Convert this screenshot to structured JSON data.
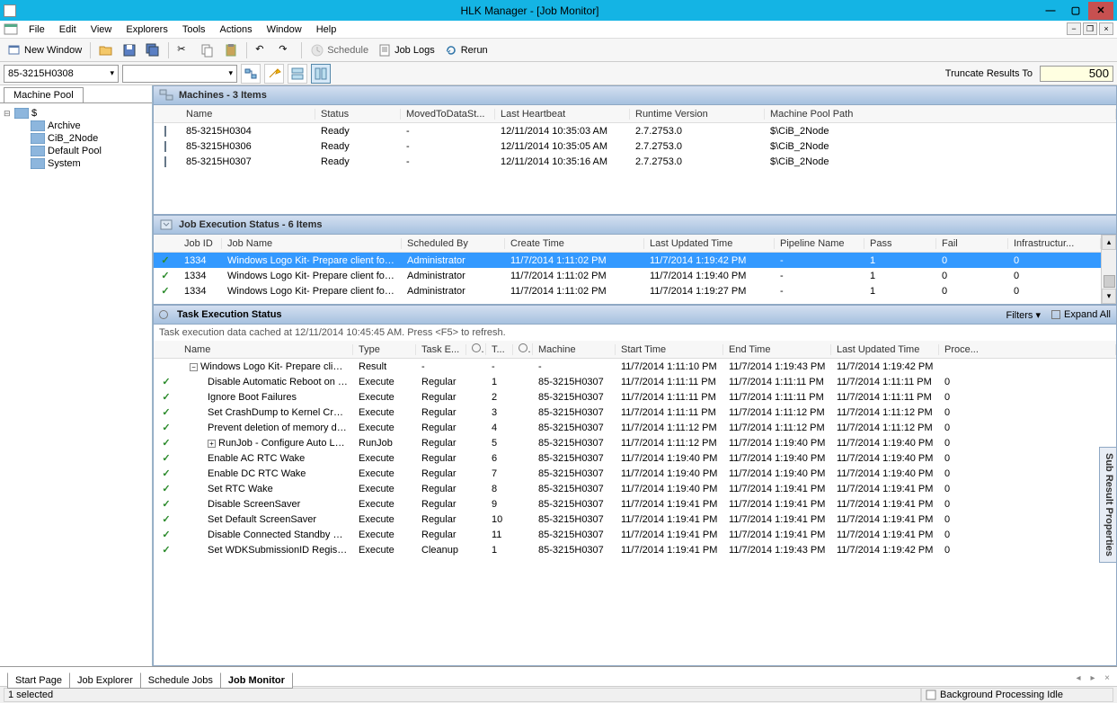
{
  "window": {
    "title": "HLK Manager - [Job Monitor]"
  },
  "menu": [
    "File",
    "Edit",
    "View",
    "Explorers",
    "Tools",
    "Actions",
    "Window",
    "Help"
  ],
  "toolbar": {
    "new_window": "New Window",
    "schedule": "Schedule",
    "job_logs": "Job Logs",
    "rerun": "Rerun"
  },
  "toolbar2": {
    "combo1": "85-3215H0308",
    "combo2": "",
    "truncate_label": "Truncate Results To",
    "truncate_value": "500"
  },
  "tree": {
    "tab": "Machine Pool",
    "root": "$",
    "children": [
      "Archive",
      "CiB_2Node",
      "Default Pool",
      "System"
    ]
  },
  "panels": {
    "machines": {
      "title": "Machines - 3 Items",
      "columns": [
        "Name",
        "Status",
        "MovedToDataSt...",
        "Last Heartbeat",
        "Runtime Version",
        "Machine Pool Path"
      ],
      "rows": [
        {
          "name": "85-3215H0304",
          "status": "Ready",
          "moved": "-",
          "hb": "12/11/2014 10:35:03 AM",
          "rt": "2.7.2753.0",
          "path": "$\\CiB_2Node"
        },
        {
          "name": "85-3215H0306",
          "status": "Ready",
          "moved": "-",
          "hb": "12/11/2014 10:35:05 AM",
          "rt": "2.7.2753.0",
          "path": "$\\CiB_2Node"
        },
        {
          "name": "85-3215H0307",
          "status": "Ready",
          "moved": "-",
          "hb": "12/11/2014 10:35:16 AM",
          "rt": "2.7.2753.0",
          "path": "$\\CiB_2Node"
        }
      ]
    },
    "jobs": {
      "title": "Job Execution Status - 6 Items",
      "columns": [
        "Job ID",
        "Job Name",
        "Scheduled By",
        "Create Time",
        "Last Updated Time",
        "Pipeline Name",
        "Pass",
        "Fail",
        "Infrastructur..."
      ],
      "rows": [
        {
          "id": "1334",
          "name": "Windows Logo Kit- Prepare client for ...",
          "by": "Administrator",
          "create": "11/7/2014 1:11:02 PM",
          "updated": "11/7/2014 1:19:42 PM",
          "pipe": "-",
          "pass": "1",
          "fail": "0",
          "infra": "0",
          "selected": true
        },
        {
          "id": "1334",
          "name": "Windows Logo Kit- Prepare client for ...",
          "by": "Administrator",
          "create": "11/7/2014 1:11:02 PM",
          "updated": "11/7/2014 1:19:40 PM",
          "pipe": "-",
          "pass": "1",
          "fail": "0",
          "infra": "0",
          "selected": false
        },
        {
          "id": "1334",
          "name": "Windows Logo Kit- Prepare client for ...",
          "by": "Administrator",
          "create": "11/7/2014 1:11:02 PM",
          "updated": "11/7/2014 1:19:27 PM",
          "pipe": "-",
          "pass": "1",
          "fail": "0",
          "infra": "0",
          "selected": false
        }
      ]
    },
    "tasks": {
      "title": "Task Execution Status",
      "filters": "Filters",
      "expand_all": "Expand All",
      "cache_msg": "Task execution data cached at 12/11/2014 10:45:45 AM. Press <F5> to refresh.",
      "columns": [
        "Name",
        "Type",
        "Task E...",
        "",
        "T...",
        "",
        "Machine",
        "Start Time",
        "End Time",
        "Last Updated Time",
        "Proce..."
      ],
      "group": {
        "name": "Windows Logo Kit- Prepare client fo...",
        "type": "Result",
        "taske": "-",
        "t": "-",
        "machine": "-",
        "start": "11/7/2014 1:11:10 PM",
        "end": "11/7/2014 1:19:43 PM",
        "updated": "11/7/2014 1:19:42 PM",
        "proc": ""
      },
      "rows": [
        {
          "name": "Disable Automatic Reboot on Bl...",
          "type": "Execute",
          "taske": "Regular",
          "t": "1",
          "machine": "85-3215H0307",
          "start": "11/7/2014 1:11:11 PM",
          "end": "11/7/2014 1:11:11 PM",
          "updated": "11/7/2014 1:11:11 PM",
          "proc": "0"
        },
        {
          "name": "Ignore Boot Failures",
          "type": "Execute",
          "taske": "Regular",
          "t": "2",
          "machine": "85-3215H0307",
          "start": "11/7/2014 1:11:11 PM",
          "end": "11/7/2014 1:11:11 PM",
          "updated": "11/7/2014 1:11:11 PM",
          "proc": "0"
        },
        {
          "name": "Set CrashDump to Kernel Crash...",
          "type": "Execute",
          "taske": "Regular",
          "t": "3",
          "machine": "85-3215H0307",
          "start": "11/7/2014 1:11:11 PM",
          "end": "11/7/2014 1:11:12 PM",
          "updated": "11/7/2014 1:11:12 PM",
          "proc": "0"
        },
        {
          "name": "Prevent deletion of memory du...",
          "type": "Execute",
          "taske": "Regular",
          "t": "4",
          "machine": "85-3215H0307",
          "start": "11/7/2014 1:11:12 PM",
          "end": "11/7/2014 1:11:12 PM",
          "updated": "11/7/2014 1:11:12 PM",
          "proc": "0"
        },
        {
          "name": "RunJob - Configure Auto Logon",
          "type": "RunJob",
          "taske": "Regular",
          "t": "5",
          "machine": "85-3215H0307",
          "start": "11/7/2014 1:11:12 PM",
          "end": "11/7/2014 1:19:40 PM",
          "updated": "11/7/2014 1:19:40 PM",
          "proc": "0",
          "expand": true
        },
        {
          "name": "Enable AC RTC Wake",
          "type": "Execute",
          "taske": "Regular",
          "t": "6",
          "machine": "85-3215H0307",
          "start": "11/7/2014 1:19:40 PM",
          "end": "11/7/2014 1:19:40 PM",
          "updated": "11/7/2014 1:19:40 PM",
          "proc": "0"
        },
        {
          "name": "Enable DC RTC Wake",
          "type": "Execute",
          "taske": "Regular",
          "t": "7",
          "machine": "85-3215H0307",
          "start": "11/7/2014 1:19:40 PM",
          "end": "11/7/2014 1:19:40 PM",
          "updated": "11/7/2014 1:19:40 PM",
          "proc": "0"
        },
        {
          "name": "Set RTC Wake",
          "type": "Execute",
          "taske": "Regular",
          "t": "8",
          "machine": "85-3215H0307",
          "start": "11/7/2014 1:19:40 PM",
          "end": "11/7/2014 1:19:41 PM",
          "updated": "11/7/2014 1:19:41 PM",
          "proc": "0"
        },
        {
          "name": "Disable ScreenSaver",
          "type": "Execute",
          "taske": "Regular",
          "t": "9",
          "machine": "85-3215H0307",
          "start": "11/7/2014 1:19:41 PM",
          "end": "11/7/2014 1:19:41 PM",
          "updated": "11/7/2014 1:19:41 PM",
          "proc": "0"
        },
        {
          "name": "Set Default ScreenSaver",
          "type": "Execute",
          "taske": "Regular",
          "t": "10",
          "machine": "85-3215H0307",
          "start": "11/7/2014 1:19:41 PM",
          "end": "11/7/2014 1:19:41 PM",
          "updated": "11/7/2014 1:19:41 PM",
          "proc": "0"
        },
        {
          "name": "Disable Connected Standby on ...",
          "type": "Execute",
          "taske": "Regular",
          "t": "11",
          "machine": "85-3215H0307",
          "start": "11/7/2014 1:19:41 PM",
          "end": "11/7/2014 1:19:41 PM",
          "updated": "11/7/2014 1:19:41 PM",
          "proc": "0"
        },
        {
          "name": "Set WDKSubmissionID Registry...",
          "type": "Execute",
          "taske": "Cleanup",
          "t": "1",
          "machine": "85-3215H0307",
          "start": "11/7/2014 1:19:41 PM",
          "end": "11/7/2014 1:19:43 PM",
          "updated": "11/7/2014 1:19:42 PM",
          "proc": "0"
        }
      ]
    }
  },
  "side_tab": "Sub Result Properties",
  "bottom_tabs": [
    "Start Page",
    "Job Explorer",
    "Schedule Jobs",
    "Job Monitor"
  ],
  "bottom_active": 3,
  "status": {
    "left": "1 selected",
    "right": "Background Processing Idle"
  },
  "colors": {
    "titlebar": "#14b4e4",
    "close": "#c75050",
    "selection": "#3399ff",
    "header_grad1": "#d3dff0",
    "header_grad2": "#a6c1df"
  }
}
